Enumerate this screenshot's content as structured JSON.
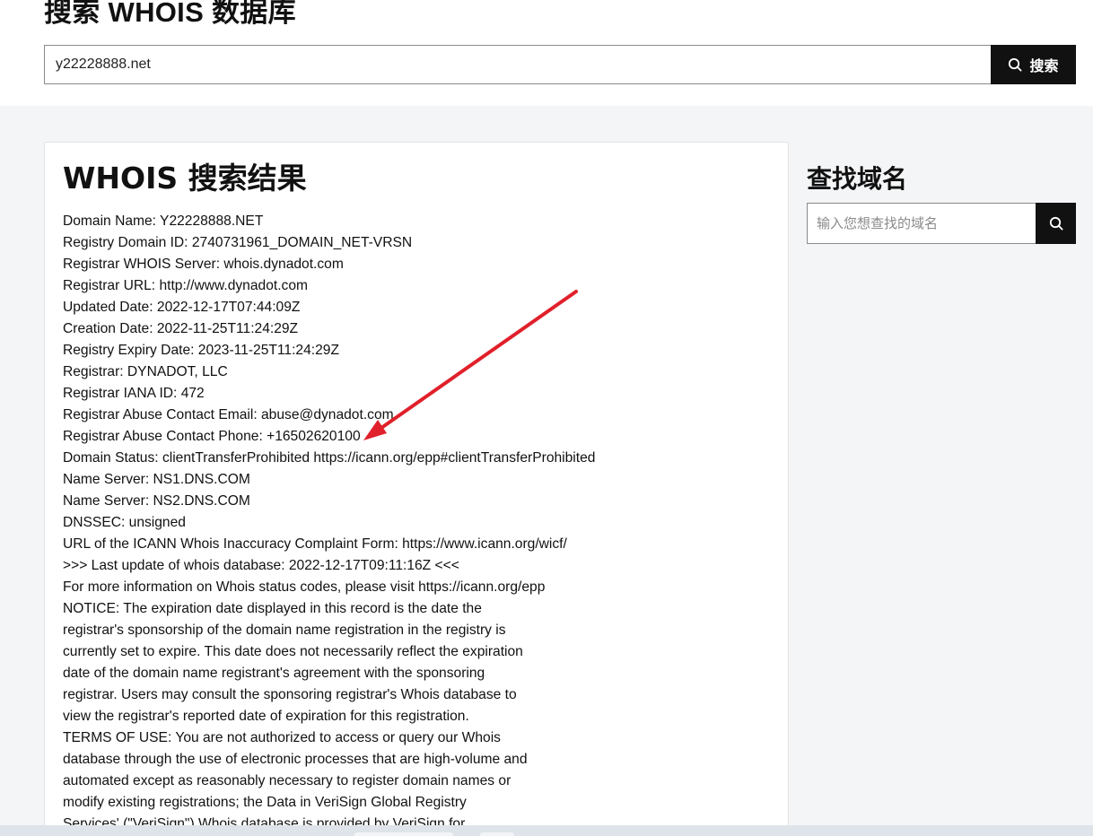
{
  "header": {
    "title": "搜索 WHOIS 数据库",
    "search_value": "y22228888.net",
    "search_button_label": "搜索"
  },
  "results": {
    "title": "WHOIS 搜索结果",
    "lines": [
      "Domain Name: Y22228888.NET",
      "Registry Domain ID: 2740731961_DOMAIN_NET-VRSN",
      "Registrar WHOIS Server: whois.dynadot.com",
      "Registrar URL: http://www.dynadot.com",
      "Updated Date: 2022-12-17T07:44:09Z",
      "Creation Date: 2022-11-25T11:24:29Z",
      "Registry Expiry Date: 2023-11-25T11:24:29Z",
      "Registrar: DYNADOT, LLC",
      "Registrar IANA ID: 472",
      "Registrar Abuse Contact Email: abuse@dynadot.com",
      "Registrar Abuse Contact Phone: +16502620100",
      "Domain Status: clientTransferProhibited https://icann.org/epp#clientTransferProhibited",
      "Name Server: NS1.DNS.COM",
      "Name Server: NS2.DNS.COM",
      "DNSSEC: unsigned",
      "URL of the ICANN Whois Inaccuracy Complaint Form: https://www.icann.org/wicf/",
      ">>> Last update of whois database: 2022-12-17T09:11:16Z <<<",
      "For more information on Whois status codes, please visit https://icann.org/epp",
      "NOTICE: The expiration date displayed in this record is the date the",
      "registrar's sponsorship of the domain name registration in the registry is",
      "currently set to expire. This date does not necessarily reflect the expiration",
      "date of the domain name registrant's agreement with the sponsoring",
      "registrar. Users may consult the sponsoring registrar's Whois database to",
      "view the registrar's reported date of expiration for this registration.",
      "TERMS OF USE: You are not authorized to access or query our Whois",
      "database through the use of electronic processes that are high-volume and",
      "automated except as reasonably necessary to register domain names or",
      "modify existing registrations; the Data in VeriSign Global Registry",
      "Services' (\"VeriSign\") Whois database is provided by VeriSign for"
    ]
  },
  "sidebar": {
    "title": "查找域名",
    "search_placeholder": "输入您想查找的域名"
  },
  "icons": {
    "main_search": "search-icon",
    "sidebar_search": "search-icon",
    "annotation": "red-arrow"
  },
  "colors": {
    "button_background": "#111111",
    "page_background": "#f4f5f7",
    "annotation_arrow": "#e0202a"
  }
}
